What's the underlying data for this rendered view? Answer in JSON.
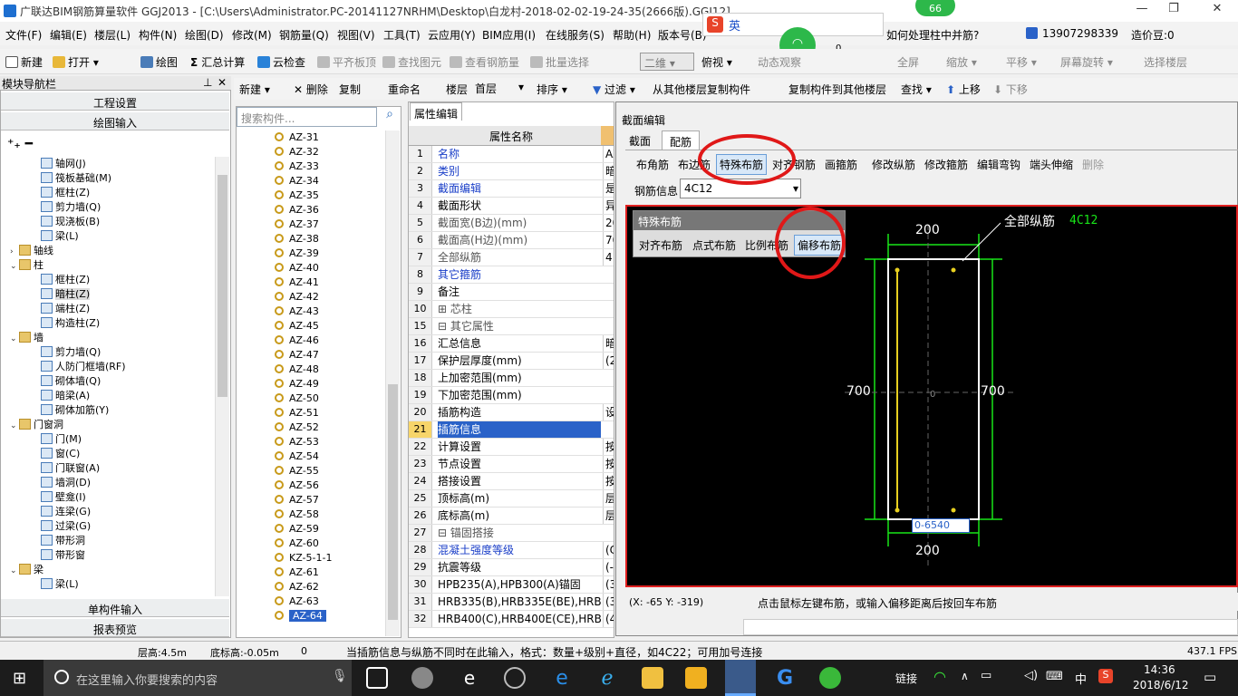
{
  "window": {
    "title": "广联达BIM钢筋算量软件 GGJ2013 - [C:\\Users\\Administrator.PC-20141127NRHM\\Desktop\\白龙村-2018-02-02-19-24-35(2666版).GGJ12]",
    "badge": "66"
  },
  "menu": [
    "文件(F)",
    "编辑(E)",
    "楼层(L)",
    "构件(N)",
    "绘图(D)",
    "修改(M)",
    "钢筋量(Q)",
    "视图(V)",
    "工具(T)",
    "云应用(Y)",
    "BIM应用(I)",
    "在线服务(S)",
    "帮助(H)",
    "版本号(B)"
  ],
  "menu_right": {
    "question": "如何处理柱中并筋?",
    "phone": "13907298339",
    "beans": "造价豆:0",
    "wifi_count": "0",
    "ime_label": "英"
  },
  "toolbar1": [
    "新建",
    "打开",
    "绘图",
    "汇总计算",
    "云检查",
    "平齐板顶",
    "查找图元",
    "查看钢筋量",
    "批量选择"
  ],
  "toolbar1_right": {
    "view_select": "二维",
    "items": [
      "俯视",
      "动态观察",
      "全屏",
      "缩放",
      "平移",
      "屏幕旋转",
      "选择楼层"
    ]
  },
  "toolbar2": {
    "items": [
      "新建",
      "删除",
      "复制",
      "重命名"
    ],
    "floor_label": "楼层",
    "floor_value": "首层",
    "sort": "排序",
    "filter": "过滤",
    "copy_from": "从其他楼层复制构件",
    "copy_to": "复制构件到其他楼层",
    "find": "查找",
    "up": "上移",
    "down": "下移"
  },
  "nav": {
    "title": "模块导航栏",
    "sections": [
      "工程设置",
      "绘图输入"
    ],
    "bottom_sections": [
      "单构件输入",
      "报表预览"
    ],
    "tree": [
      {
        "label": "轴网(J)",
        "level": 2
      },
      {
        "label": "筏板基础(M)",
        "level": 2
      },
      {
        "label": "框柱(Z)",
        "level": 2
      },
      {
        "label": "剪力墙(Q)",
        "level": 2
      },
      {
        "label": "现浇板(B)",
        "level": 2
      },
      {
        "label": "梁(L)",
        "level": 2
      },
      {
        "label": "轴线",
        "level": 1,
        "folder": true,
        "arrow": "›"
      },
      {
        "label": "柱",
        "level": 1,
        "folder": true,
        "arrow": "⌄"
      },
      {
        "label": "框柱(Z)",
        "level": 2
      },
      {
        "label": "暗柱(Z)",
        "level": 2,
        "selected": true
      },
      {
        "label": "端柱(Z)",
        "level": 2
      },
      {
        "label": "构造柱(Z)",
        "level": 2
      },
      {
        "label": "墙",
        "level": 1,
        "folder": true,
        "arrow": "⌄"
      },
      {
        "label": "剪力墙(Q)",
        "level": 2
      },
      {
        "label": "人防门框墙(RF)",
        "level": 2
      },
      {
        "label": "砌体墙(Q)",
        "level": 2
      },
      {
        "label": "暗梁(A)",
        "level": 2
      },
      {
        "label": "砌体加筋(Y)",
        "level": 2
      },
      {
        "label": "门窗洞",
        "level": 1,
        "folder": true,
        "arrow": "⌄"
      },
      {
        "label": "门(M)",
        "level": 2
      },
      {
        "label": "窗(C)",
        "level": 2
      },
      {
        "label": "门联窗(A)",
        "level": 2
      },
      {
        "label": "墙洞(D)",
        "level": 2
      },
      {
        "label": "壁龛(I)",
        "level": 2
      },
      {
        "label": "连梁(G)",
        "level": 2
      },
      {
        "label": "过梁(G)",
        "level": 2
      },
      {
        "label": "带形洞",
        "level": 2
      },
      {
        "label": "带形窗",
        "level": 2
      },
      {
        "label": "梁",
        "level": 1,
        "folder": true,
        "arrow": "⌄"
      },
      {
        "label": "梁(L)",
        "level": 2
      }
    ]
  },
  "list": {
    "search_placeholder": "搜索构件...",
    "items": [
      "AZ-31",
      "AZ-32",
      "AZ-33",
      "AZ-34",
      "AZ-35",
      "AZ-36",
      "AZ-37",
      "AZ-38",
      "AZ-39",
      "AZ-40",
      "AZ-41",
      "AZ-42",
      "AZ-43",
      "AZ-45",
      "AZ-46",
      "AZ-47",
      "AZ-48",
      "AZ-49",
      "AZ-50",
      "AZ-51",
      "AZ-52",
      "AZ-53",
      "AZ-54",
      "AZ-55",
      "AZ-56",
      "AZ-57",
      "AZ-58",
      "AZ-59",
      "AZ-60",
      "KZ-5-1-1",
      "AZ-61",
      "AZ-62",
      "AZ-63",
      "AZ-64"
    ],
    "selected": "AZ-64"
  },
  "props": {
    "tab": "属性编辑",
    "header": "属性名称",
    "rows": [
      {
        "num": "1",
        "name": "名称",
        "value": "AZ",
        "style": "blue"
      },
      {
        "num": "2",
        "name": "类别",
        "value": "暗",
        "style": "blue"
      },
      {
        "num": "3",
        "name": "截面编辑",
        "value": "是",
        "style": "blue"
      },
      {
        "num": "4",
        "name": "截面形状",
        "value": "异",
        "style": ""
      },
      {
        "num": "5",
        "name": "截面宽(B边)(mm)",
        "value": "20",
        "style": "gray"
      },
      {
        "num": "6",
        "name": "截面高(H边)(mm)",
        "value": "70",
        "style": "gray"
      },
      {
        "num": "7",
        "name": "全部纵筋",
        "value": "4",
        "style": "gray"
      },
      {
        "num": "8",
        "name": "其它箍筋",
        "value": "",
        "style": "blue"
      },
      {
        "num": "9",
        "name": "备注",
        "value": "",
        "style": ""
      },
      {
        "num": "10",
        "name": "⊞ 芯柱",
        "value": "",
        "style": "gray"
      },
      {
        "num": "15",
        "name": "⊟ 其它属性",
        "value": "",
        "style": "gray"
      },
      {
        "num": "16",
        "name": "汇总信息",
        "value": "暗",
        "style": ""
      },
      {
        "num": "17",
        "name": "保护层厚度(mm)",
        "value": "(2",
        "style": ""
      },
      {
        "num": "18",
        "name": "上加密范围(mm)",
        "value": "",
        "style": ""
      },
      {
        "num": "19",
        "name": "下加密范围(mm)",
        "value": "",
        "style": ""
      },
      {
        "num": "20",
        "name": "插筋构造",
        "value": "设",
        "style": ""
      },
      {
        "num": "21",
        "name": "插筋信息",
        "value": "",
        "style": "sel"
      },
      {
        "num": "22",
        "name": "计算设置",
        "value": "按",
        "style": ""
      },
      {
        "num": "23",
        "name": "节点设置",
        "value": "按",
        "style": ""
      },
      {
        "num": "24",
        "name": "搭接设置",
        "value": "按",
        "style": ""
      },
      {
        "num": "25",
        "name": "顶标高(m)",
        "value": "层",
        "style": ""
      },
      {
        "num": "26",
        "name": "底标高(m)",
        "value": "层",
        "style": ""
      },
      {
        "num": "27",
        "name": "⊟ 锚固搭接",
        "value": "",
        "style": "gray"
      },
      {
        "num": "28",
        "name": "混凝土强度等级",
        "value": "(C",
        "style": "blue"
      },
      {
        "num": "29",
        "name": "抗震等级",
        "value": "(-",
        "style": ""
      },
      {
        "num": "30",
        "name": "HPB235(A),HPB300(A)锚固",
        "value": "(3",
        "style": ""
      },
      {
        "num": "31",
        "name": "HRB335(B),HRB335E(BE),HRBF",
        "value": "(3",
        "style": ""
      },
      {
        "num": "32",
        "name": "HRB400(C),HRB400E(CE),HRBF",
        "value": "(4",
        "style": ""
      }
    ]
  },
  "dialog": {
    "title": "截面编辑",
    "tabs": [
      "截面",
      "配筋"
    ],
    "toolbar": [
      "布角筋",
      "布边筋",
      "特殊布筋",
      "对齐钢筋",
      "画箍筋",
      "修改纵筋",
      "修改箍筋",
      "编辑弯钩",
      "端头伸缩",
      "删除"
    ],
    "rebar_label": "钢筋信息",
    "rebar_value": "4C12",
    "popup_title": "特殊布筋",
    "popup_items": [
      "对齐布筋",
      "点式布筋",
      "比例布筋",
      "偏移布筋"
    ],
    "canvas": {
      "dim_top": "200",
      "dim_bottom": "200",
      "dim_left": "700",
      "dim_right": "700",
      "leader_label": "全部纵筋",
      "leader_value": "4C12",
      "input_value": "0-6540",
      "origin": "0"
    },
    "coord": "(X: -65 Y: -319)",
    "hint": "点击鼠标左键布筋，或输入偏移距离后按回车布筋"
  },
  "status": {
    "floor_height": "层高:4.5m",
    "bottom_elev": "底标高:-0.05m",
    "zero": "0",
    "message": "当插筋信息与纵筋不同时在此输入，格式：数量+级别+直径，如4C22；可用加号连接",
    "fps": "437.1 FPS"
  },
  "taskbar": {
    "search": "在这里输入你要搜索的内容",
    "link": "链接",
    "lang": "中",
    "time": "14:36",
    "date": "2018/6/12"
  },
  "colors": {
    "accent": "#2a62c8",
    "highlight": "#e01818",
    "canvas_green": "#19e619"
  }
}
